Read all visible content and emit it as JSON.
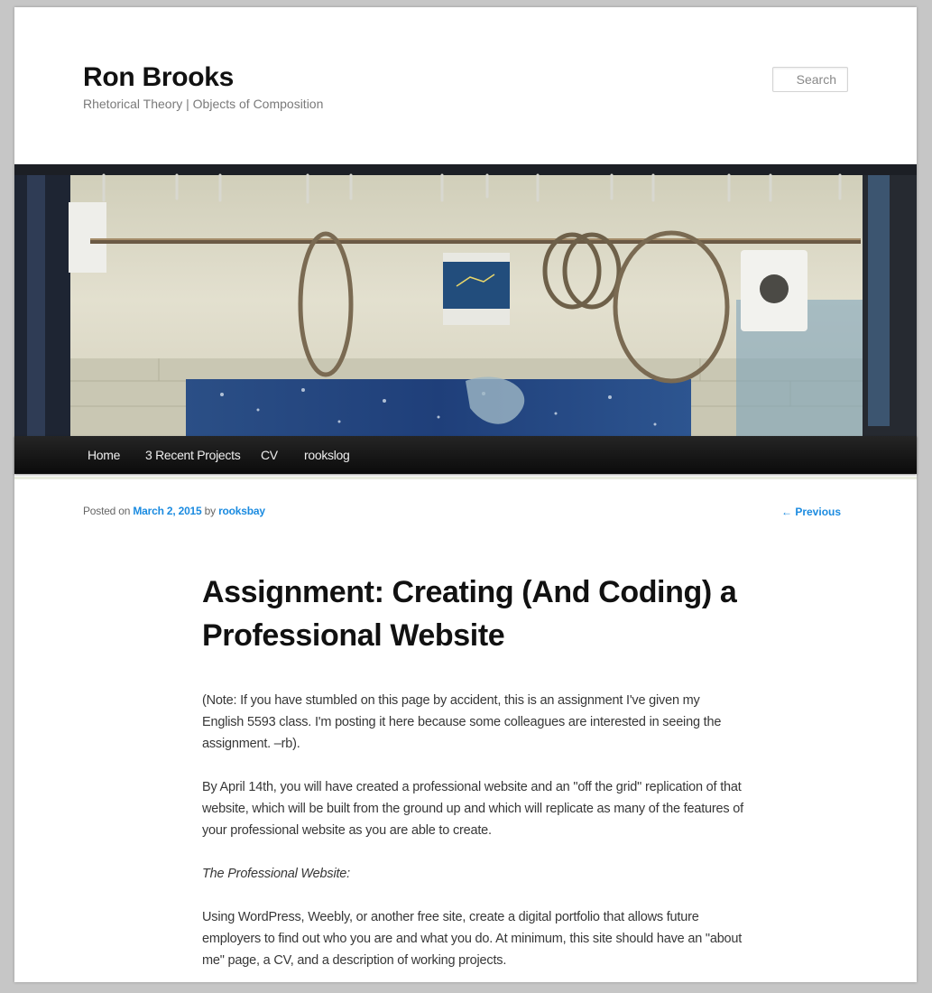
{
  "site": {
    "title": "Ron Brooks",
    "description": "Rhetorical Theory | Objects of Composition"
  },
  "search": {
    "placeholder": "Search"
  },
  "nav": {
    "items": [
      {
        "label": "Home"
      },
      {
        "label": "3 Recent Projects"
      },
      {
        "label": "CV"
      },
      {
        "label": "rookslog"
      }
    ]
  },
  "post": {
    "meta": {
      "posted_on": "Posted on",
      "date": "March 2, 2015",
      "by": "by",
      "author": "rooksbay"
    },
    "previous_link": "← Previous",
    "title": "Assignment: Creating (And Coding) a Professional Website",
    "paragraphs": [
      "(Note: If you have stumbled on this page by accident, this is an assignment I've given my English 5593 class. I'm posting it here because some colleagues are interested in seeing the assignment. –rb).",
      "By April 14th, you will have created a professional website and an \"off the grid\" replication of that website, which will be built from the ground up and which will replicate as many of the features of your professional website as you are able to create.",
      "The Professional Website:",
      "Using WordPress, Weebly, or another free site, create a digital portfolio that allows future employers to find out who you are and what you do. At minimum, this site should have an \"about me\" page, a CV, and a description of working projects."
    ]
  },
  "colors": {
    "link": "#1b8be0",
    "nav_bg": "#111111",
    "page_bg": "#c6c6c6"
  }
}
